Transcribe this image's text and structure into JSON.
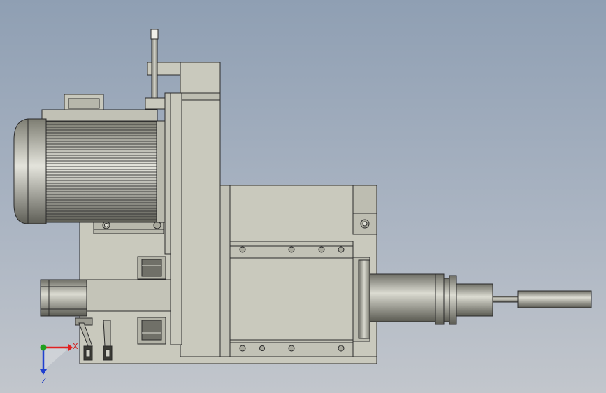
{
  "triad": {
    "x_label": "X",
    "z_label": "Z"
  },
  "colors": {
    "x_axis": "#e02020",
    "y_axis": "#1fa01f",
    "z_axis": "#2040d0",
    "part_fill": "#c9c9bd",
    "part_edge": "#2a2a2a"
  },
  "icons": {
    "triad": "axis-triad-icon"
  }
}
